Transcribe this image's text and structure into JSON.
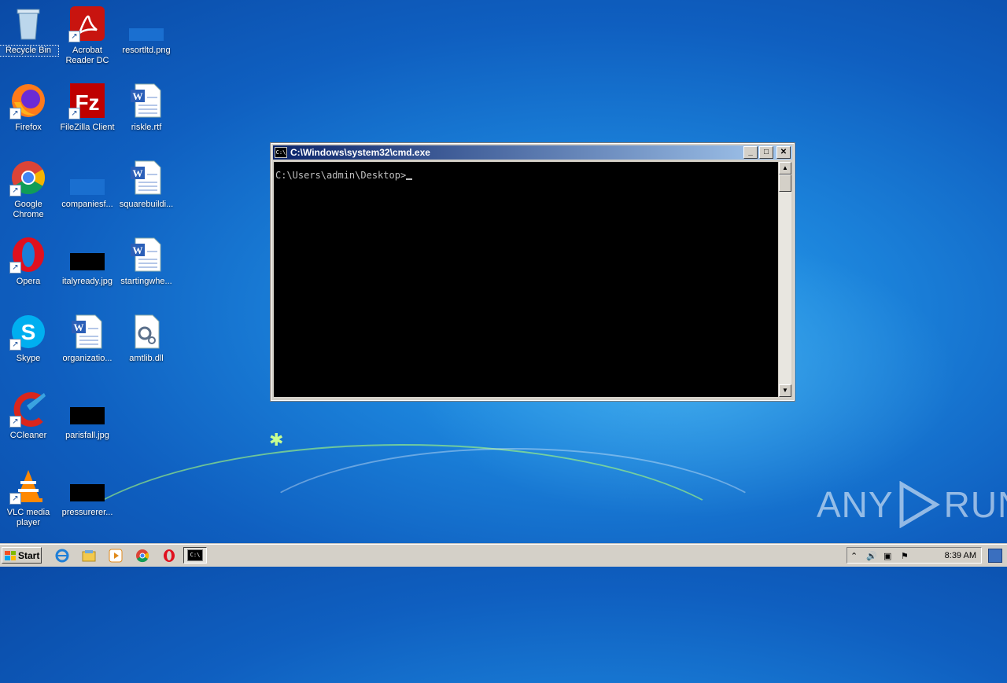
{
  "desktop": {
    "icons": [
      {
        "label": "Recycle Bin"
      },
      {
        "label": "Acrobat Reader DC"
      },
      {
        "label": "resortltd.png"
      },
      {
        "label": "Firefox"
      },
      {
        "label": "FileZilla Client"
      },
      {
        "label": "riskle.rtf"
      },
      {
        "label": "Google Chrome"
      },
      {
        "label": "companiesf..."
      },
      {
        "label": "squarebuildi..."
      },
      {
        "label": "Opera"
      },
      {
        "label": "italyready.jpg"
      },
      {
        "label": "startingwhe..."
      },
      {
        "label": "Skype"
      },
      {
        "label": "organizatio..."
      },
      {
        "label": "amtlib.dll"
      },
      {
        "label": "CCleaner"
      },
      {
        "label": "parisfall.jpg"
      },
      {
        "label": "VLC media player"
      },
      {
        "label": "pressurerer..."
      }
    ]
  },
  "window": {
    "title": "C:\\Windows\\system32\\cmd.exe",
    "icon_text": "C:\\",
    "prompt": "C:\\Users\\admin\\Desktop>",
    "buttons": {
      "minimize": "_",
      "maximize": "□",
      "close": "✕"
    }
  },
  "taskbar": {
    "start_label": "Start",
    "clock": "8:39 AM"
  },
  "watermark": {
    "left": "ANY",
    "right": "RUN"
  },
  "colors": {
    "accent": "#0a246a",
    "desktop": "#1a7fd8"
  }
}
